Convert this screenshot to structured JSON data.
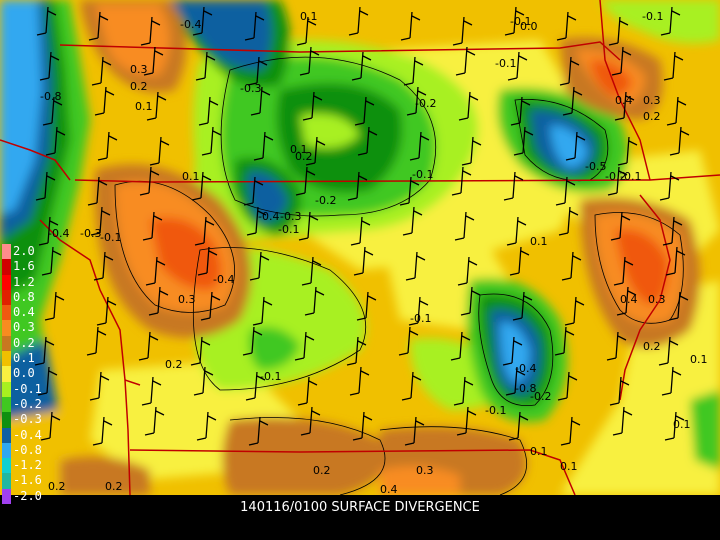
{
  "title": "140116/0100 SURFACE DIVERGENCE",
  "legend": {
    "levels": [
      {
        "label": "2.0",
        "color": "#ff8c8c"
      },
      {
        "label": "1.6",
        "color": "#d00000"
      },
      {
        "label": "1.2",
        "color": "#ff0000"
      },
      {
        "label": "0.8",
        "color": "#e02000"
      },
      {
        "label": "0.4",
        "color": "#f05810"
      },
      {
        "label": "0.3",
        "color": "#f88c20"
      },
      {
        "label": "0.2",
        "color": "#c87820"
      },
      {
        "label": "0.1",
        "color": "#f0c000"
      },
      {
        "label": "0.0",
        "color": "#f8f040"
      },
      {
        "label": "-0.1",
        "color": "#a8f020"
      },
      {
        "label": "-0.2",
        "color": "#40c820"
      },
      {
        "label": "-0.3",
        "color": "#109010"
      },
      {
        "label": "-0.4",
        "color": "#1060a0"
      },
      {
        "label": "-0.8",
        "color": "#30a8f0"
      },
      {
        "label": "-1.2",
        "color": "#10d0d0"
      },
      {
        "label": "-1.6",
        "color": "#20b8a0"
      },
      {
        "label": "-2.0",
        "color": "#a040f0"
      }
    ]
  },
  "contour_labels": [
    "-0.4",
    "0.1",
    "-0.1",
    "-0.1",
    "0.3",
    "0.2",
    "0.1",
    "-0.3",
    "-0.8",
    "-0.1",
    "-0.2",
    "0.4",
    "0.3",
    "0.2",
    "0.1",
    "-0.1",
    "-0.4",
    "-0.2",
    "-0.1",
    "-0.4",
    "-0.3",
    "-0.1",
    "0.1",
    "-0.5",
    "-0.2",
    "-0.1",
    "0.1",
    "0.2",
    "-0.4",
    "0.3",
    "0.2",
    "0.3",
    "0.4",
    "0.1",
    "0.2",
    "-0.1",
    "-0.4",
    "-0.8",
    "-0.2",
    "-0.1",
    "0.1",
    "0.2",
    "0.3",
    "0.4",
    "0.2",
    "0.2",
    "0.1",
    "0.1",
    "0.0",
    "-0.1",
    "-0.3"
  ]
}
